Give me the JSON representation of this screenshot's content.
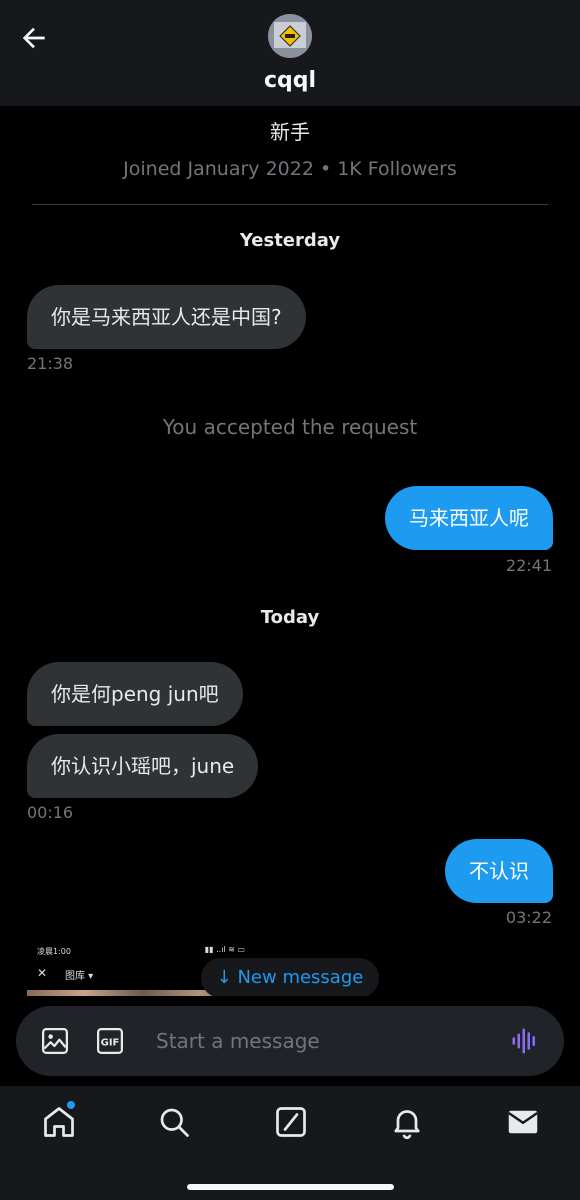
{
  "header": {
    "name": "cqql",
    "bio": "新手",
    "meta": "Joined January 2022 • 1K Followers"
  },
  "day_labels": [
    "Yesterday",
    "Today"
  ],
  "system_message": "You accepted the request",
  "messages": [
    {
      "direction": "incoming",
      "text": "你是马来西亚人还是中国?",
      "time": "21:38"
    },
    {
      "direction": "outgoing",
      "text": "马来西亚人呢",
      "time": "22:41"
    },
    {
      "direction": "incoming",
      "text": "你是何peng jun吧",
      "time": ""
    },
    {
      "direction": "incoming",
      "text": "你认识小瑶吧，june",
      "time": "00:16"
    },
    {
      "direction": "outgoing",
      "text": "不认识",
      "time": "03:22"
    }
  ],
  "screenshot_thumb": {
    "status_time": "凌晨1:00",
    "title": "图库 ▾",
    "close": "✕"
  },
  "new_message_label": "↓ New message",
  "composer": {
    "placeholder": "Start a message",
    "gif_label": "GIF"
  },
  "tabbar": {
    "items": [
      "home-icon",
      "search-icon",
      "grok-icon",
      "notifications-icon",
      "messages-icon"
    ],
    "home_has_badge": true
  },
  "colors": {
    "accent": "#1d9bf0",
    "incoming_bubble": "#2f3336",
    "background": "#000000",
    "muted_text": "#71767b",
    "voice_accent": "#8b6cf6"
  }
}
